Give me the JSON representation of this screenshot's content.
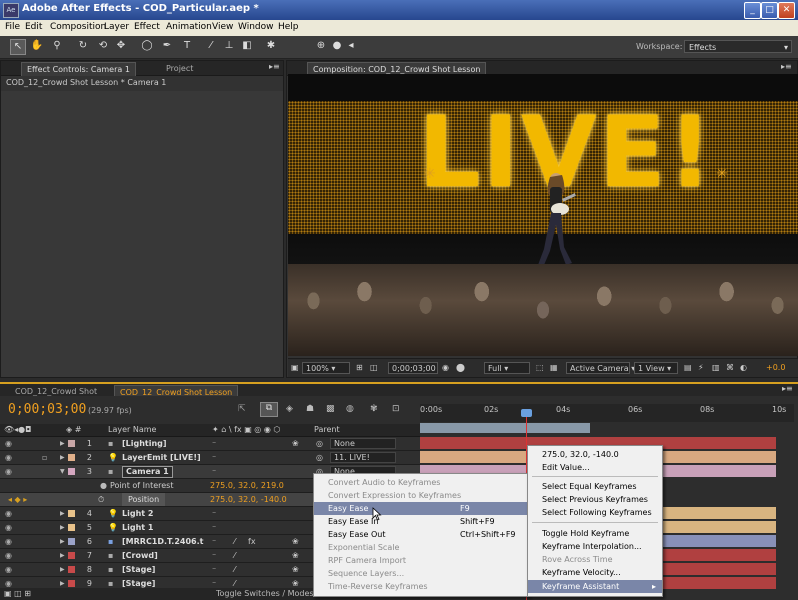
{
  "window": {
    "app_icon": "Ae",
    "title": "Adobe After Effects - COD_Particular.aep *",
    "min": "_",
    "max": "□",
    "close": "✕"
  },
  "menu": [
    "File",
    "Edit",
    "Composition",
    "Layer",
    "Effect",
    "Animation",
    "View",
    "Window",
    "Help"
  ],
  "toolbar": {
    "workspace_label": "Workspace:",
    "workspace_value": "Effects"
  },
  "left_panel": {
    "tab_effect_controls": "Effect Controls: Camera 1",
    "tab_project": "Project",
    "breadcrumb": "COD_12_Crowd Shot Lesson * Camera 1"
  },
  "comp_panel": {
    "tab": "Composition: COD_12_Crowd Shot Lesson",
    "stage_text": "LIVE!",
    "footer": {
      "zoom": "100%",
      "timecode": "0;00;03;00",
      "resolution": "Full",
      "camera": "Active Camera",
      "views": "1 View",
      "exposure": "+0.0"
    }
  },
  "timeline": {
    "tabs": [
      "COD_12_Crowd Shot",
      "COD_12_Crowd Shot Lesson"
    ],
    "timecode": "0;00;03;00",
    "fps": "(29.97 fps)",
    "col_layer_name": "Layer Name",
    "col_parent": "Parent",
    "ruler": [
      "0:00s",
      "02s",
      "04s",
      "06s",
      "08s",
      "10s"
    ],
    "layers": [
      {
        "num": "1",
        "name": "[Lighting]",
        "parent": "None",
        "color": "#c9a7a7"
      },
      {
        "num": "2",
        "name": "LayerEmit [LIVE!]",
        "parent": "11. LIVE!",
        "color": "#e0b08a"
      },
      {
        "num": "3",
        "name": "Camera 1",
        "parent": "None",
        "color": "#d4a7c0"
      },
      {
        "num": "",
        "name": "Point of Interest",
        "value": "275.0, 32.0, 219.0"
      },
      {
        "num": "",
        "name": "Position",
        "value": "275.0, 32.0, -140.0"
      },
      {
        "num": "4",
        "name": "Light 2",
        "parent": "",
        "color": "#e8c28a"
      },
      {
        "num": "5",
        "name": "Light 1",
        "parent": "",
        "color": "#e8c28a"
      },
      {
        "num": "6",
        "name": "[MRRC1D.T.2406.t",
        "parent": "",
        "color": "#9aa2c8"
      },
      {
        "num": "7",
        "name": "[Crowd]",
        "parent": "",
        "color": "#c84a4a"
      },
      {
        "num": "8",
        "name": "[Stage]",
        "parent": "",
        "color": "#c84a4a"
      },
      {
        "num": "9",
        "name": "[Stage]",
        "parent": "",
        "color": "#c84a4a"
      }
    ],
    "toggle_label": "Toggle Switches / Modes"
  },
  "context_menu": {
    "items": [
      {
        "label": "Convert Audio to Keyframes",
        "shortcut": "",
        "disabled": true
      },
      {
        "label": "Convert Expression to Keyframes",
        "shortcut": "",
        "disabled": true
      },
      {
        "label": "Easy Ease",
        "shortcut": "F9",
        "disabled": false,
        "highlight": true
      },
      {
        "label": "Easy Ease In",
        "shortcut": "Shift+F9",
        "disabled": false
      },
      {
        "label": "Easy Ease Out",
        "shortcut": "Ctrl+Shift+F9",
        "disabled": false
      },
      {
        "label": "Exponential Scale",
        "shortcut": "",
        "disabled": true
      },
      {
        "label": "RPF Camera Import",
        "shortcut": "",
        "disabled": true
      },
      {
        "label": "Sequence Layers...",
        "shortcut": "",
        "disabled": true
      },
      {
        "label": "Time-Reverse Keyframes",
        "shortcut": "",
        "disabled": true
      }
    ]
  },
  "keyframe_menu": {
    "items": [
      {
        "label": "275.0, 32.0, -140.0",
        "disabled": false
      },
      {
        "label": "Edit Value...",
        "disabled": false
      },
      {
        "sep": true
      },
      {
        "label": "Select Equal Keyframes",
        "disabled": false
      },
      {
        "label": "Select Previous Keyframes",
        "disabled": false
      },
      {
        "label": "Select Following Keyframes",
        "disabled": false
      },
      {
        "sep": true
      },
      {
        "label": "Toggle Hold Keyframe",
        "disabled": false
      },
      {
        "label": "Keyframe Interpolation...",
        "disabled": false
      },
      {
        "label": "Rove Across Time",
        "disabled": true
      },
      {
        "label": "Keyframe Velocity...",
        "disabled": false
      },
      {
        "label": "Keyframe Assistant",
        "disabled": false,
        "highlight": true,
        "submenu": "▸"
      }
    ]
  }
}
